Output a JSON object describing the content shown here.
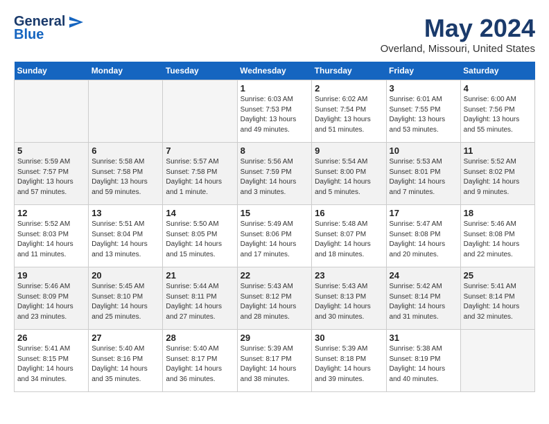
{
  "header": {
    "logo_line1": "General",
    "logo_line2": "Blue",
    "month_title": "May 2024",
    "location": "Overland, Missouri, United States"
  },
  "weekdays": [
    "Sunday",
    "Monday",
    "Tuesday",
    "Wednesday",
    "Thursday",
    "Friday",
    "Saturday"
  ],
  "weeks": [
    [
      {
        "day": "",
        "info": ""
      },
      {
        "day": "",
        "info": ""
      },
      {
        "day": "",
        "info": ""
      },
      {
        "day": "1",
        "info": "Sunrise: 6:03 AM\nSunset: 7:53 PM\nDaylight: 13 hours\nand 49 minutes."
      },
      {
        "day": "2",
        "info": "Sunrise: 6:02 AM\nSunset: 7:54 PM\nDaylight: 13 hours\nand 51 minutes."
      },
      {
        "day": "3",
        "info": "Sunrise: 6:01 AM\nSunset: 7:55 PM\nDaylight: 13 hours\nand 53 minutes."
      },
      {
        "day": "4",
        "info": "Sunrise: 6:00 AM\nSunset: 7:56 PM\nDaylight: 13 hours\nand 55 minutes."
      }
    ],
    [
      {
        "day": "5",
        "info": "Sunrise: 5:59 AM\nSunset: 7:57 PM\nDaylight: 13 hours\nand 57 minutes."
      },
      {
        "day": "6",
        "info": "Sunrise: 5:58 AM\nSunset: 7:58 PM\nDaylight: 13 hours\nand 59 minutes."
      },
      {
        "day": "7",
        "info": "Sunrise: 5:57 AM\nSunset: 7:58 PM\nDaylight: 14 hours\nand 1 minute."
      },
      {
        "day": "8",
        "info": "Sunrise: 5:56 AM\nSunset: 7:59 PM\nDaylight: 14 hours\nand 3 minutes."
      },
      {
        "day": "9",
        "info": "Sunrise: 5:54 AM\nSunset: 8:00 PM\nDaylight: 14 hours\nand 5 minutes."
      },
      {
        "day": "10",
        "info": "Sunrise: 5:53 AM\nSunset: 8:01 PM\nDaylight: 14 hours\nand 7 minutes."
      },
      {
        "day": "11",
        "info": "Sunrise: 5:52 AM\nSunset: 8:02 PM\nDaylight: 14 hours\nand 9 minutes."
      }
    ],
    [
      {
        "day": "12",
        "info": "Sunrise: 5:52 AM\nSunset: 8:03 PM\nDaylight: 14 hours\nand 11 minutes."
      },
      {
        "day": "13",
        "info": "Sunrise: 5:51 AM\nSunset: 8:04 PM\nDaylight: 14 hours\nand 13 minutes."
      },
      {
        "day": "14",
        "info": "Sunrise: 5:50 AM\nSunset: 8:05 PM\nDaylight: 14 hours\nand 15 minutes."
      },
      {
        "day": "15",
        "info": "Sunrise: 5:49 AM\nSunset: 8:06 PM\nDaylight: 14 hours\nand 17 minutes."
      },
      {
        "day": "16",
        "info": "Sunrise: 5:48 AM\nSunset: 8:07 PM\nDaylight: 14 hours\nand 18 minutes."
      },
      {
        "day": "17",
        "info": "Sunrise: 5:47 AM\nSunset: 8:08 PM\nDaylight: 14 hours\nand 20 minutes."
      },
      {
        "day": "18",
        "info": "Sunrise: 5:46 AM\nSunset: 8:08 PM\nDaylight: 14 hours\nand 22 minutes."
      }
    ],
    [
      {
        "day": "19",
        "info": "Sunrise: 5:46 AM\nSunset: 8:09 PM\nDaylight: 14 hours\nand 23 minutes."
      },
      {
        "day": "20",
        "info": "Sunrise: 5:45 AM\nSunset: 8:10 PM\nDaylight: 14 hours\nand 25 minutes."
      },
      {
        "day": "21",
        "info": "Sunrise: 5:44 AM\nSunset: 8:11 PM\nDaylight: 14 hours\nand 27 minutes."
      },
      {
        "day": "22",
        "info": "Sunrise: 5:43 AM\nSunset: 8:12 PM\nDaylight: 14 hours\nand 28 minutes."
      },
      {
        "day": "23",
        "info": "Sunrise: 5:43 AM\nSunset: 8:13 PM\nDaylight: 14 hours\nand 30 minutes."
      },
      {
        "day": "24",
        "info": "Sunrise: 5:42 AM\nSunset: 8:14 PM\nDaylight: 14 hours\nand 31 minutes."
      },
      {
        "day": "25",
        "info": "Sunrise: 5:41 AM\nSunset: 8:14 PM\nDaylight: 14 hours\nand 32 minutes."
      }
    ],
    [
      {
        "day": "26",
        "info": "Sunrise: 5:41 AM\nSunset: 8:15 PM\nDaylight: 14 hours\nand 34 minutes."
      },
      {
        "day": "27",
        "info": "Sunrise: 5:40 AM\nSunset: 8:16 PM\nDaylight: 14 hours\nand 35 minutes."
      },
      {
        "day": "28",
        "info": "Sunrise: 5:40 AM\nSunset: 8:17 PM\nDaylight: 14 hours\nand 36 minutes."
      },
      {
        "day": "29",
        "info": "Sunrise: 5:39 AM\nSunset: 8:17 PM\nDaylight: 14 hours\nand 38 minutes."
      },
      {
        "day": "30",
        "info": "Sunrise: 5:39 AM\nSunset: 8:18 PM\nDaylight: 14 hours\nand 39 minutes."
      },
      {
        "day": "31",
        "info": "Sunrise: 5:38 AM\nSunset: 8:19 PM\nDaylight: 14 hours\nand 40 minutes."
      },
      {
        "day": "",
        "info": ""
      }
    ]
  ]
}
